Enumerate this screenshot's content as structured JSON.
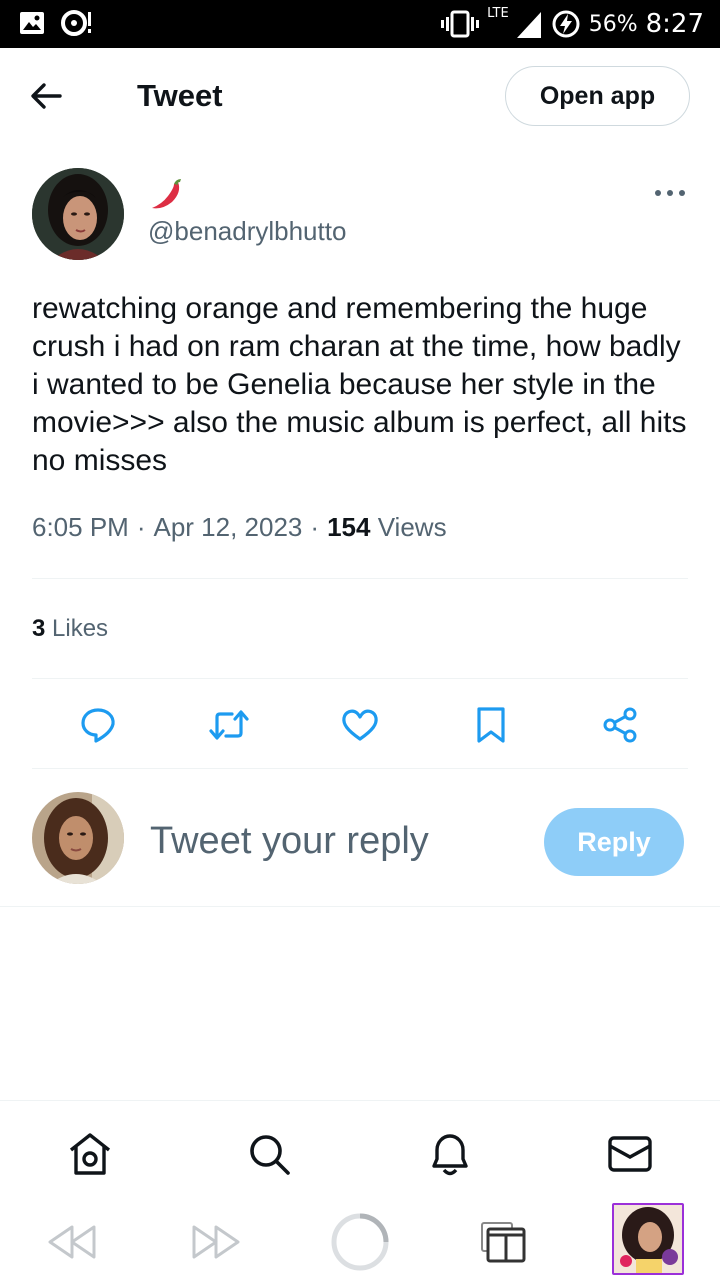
{
  "status_bar": {
    "network": "LTE",
    "battery_percent": "56%",
    "time": "8:27",
    "icons": [
      "image-icon",
      "sync-icon",
      "vibrate-icon",
      "signal-icon",
      "battery-charging-icon"
    ]
  },
  "header": {
    "back_icon": "arrow-left-icon",
    "title": "Tweet",
    "open_app_label": "Open app"
  },
  "tweet": {
    "display_name_emoji": "chili-pepper",
    "handle": "@benadrylbhutto",
    "text": "rewatching orange and remembering the huge crush i had on ram charan at the time, how badly i wanted to be Genelia because her style in the movie>>> also the music album is perfect, all hits no misses",
    "time": "6:05 PM",
    "date": "Apr 12, 2023",
    "views_count": "154",
    "views_label": "Views",
    "separator": "·",
    "likes_count": "3",
    "likes_label": "Likes"
  },
  "actions": [
    "reply-icon",
    "retweet-icon",
    "like-icon",
    "bookmark-icon",
    "share-icon"
  ],
  "reply": {
    "placeholder": "Tweet your reply",
    "button_label": "Reply"
  },
  "bottom_nav": [
    "home-icon",
    "search-icon",
    "notifications-icon",
    "messages-icon"
  ],
  "browser_bar": [
    "back-icon",
    "forward-icon",
    "loading-icon",
    "tabs-icon",
    "tab-thumbnail"
  ],
  "colors": {
    "text_primary": "#0f1419",
    "text_secondary": "#536471",
    "divider": "#eff3f4",
    "reply_button": "#8ecdf8",
    "icon_blue": "#1d9bf0",
    "tab_border": "#9b30d9"
  }
}
